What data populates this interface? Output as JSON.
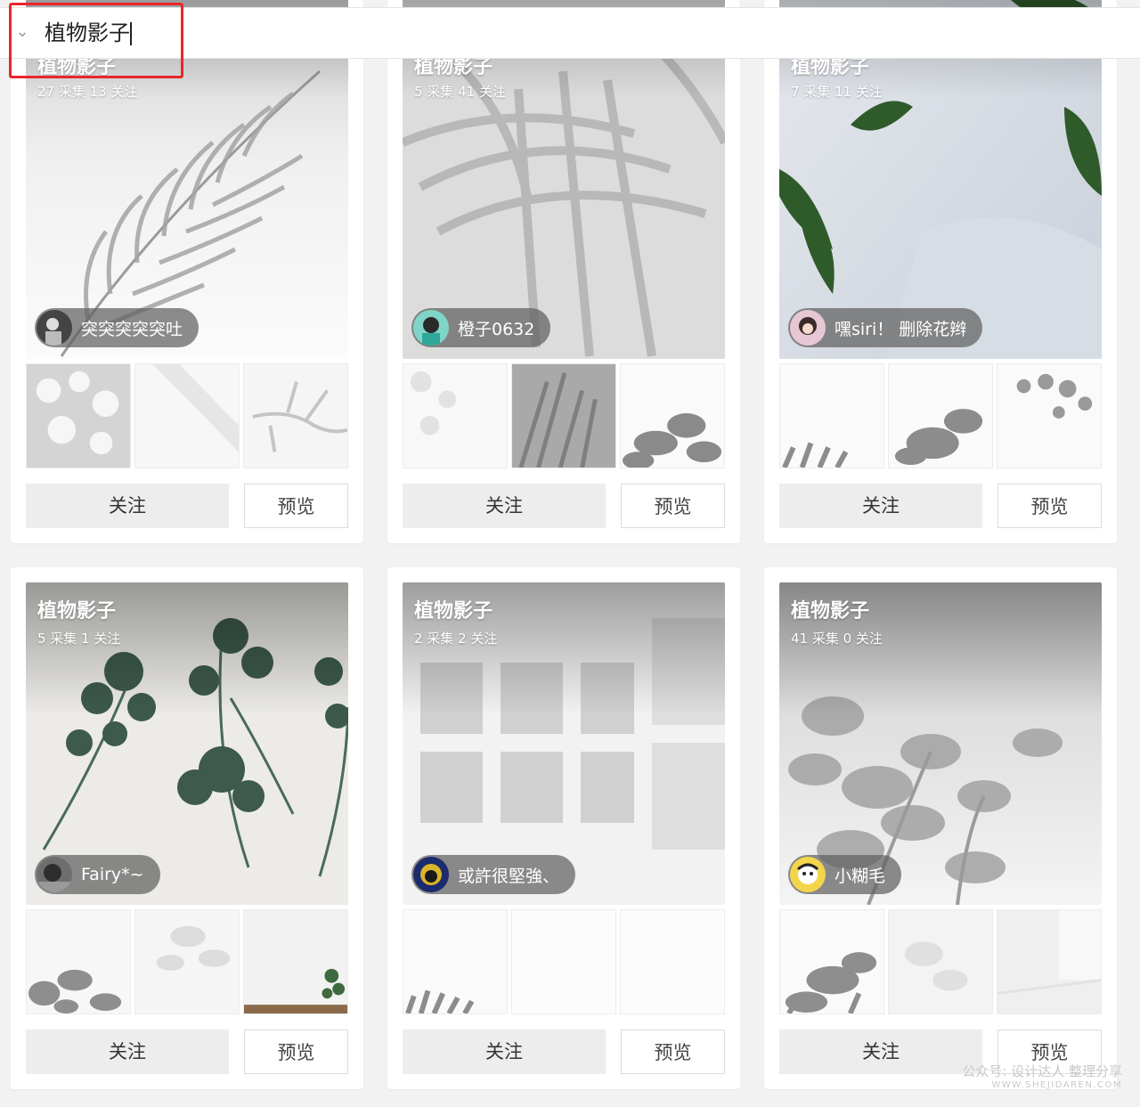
{
  "search": {
    "query": "植物影子"
  },
  "cards": [
    {
      "title": "植物影子",
      "stats": "27 采集  13 关注",
      "user": "突突突突突吐",
      "follow": "关注",
      "preview": "预览"
    },
    {
      "title": "植物影子",
      "stats": "5 采集  41 关注",
      "user": "橙子0632",
      "follow": "关注",
      "preview": "预览"
    },
    {
      "title": "植物影子",
      "stats": "7 采集  11 关注",
      "user": "嘿siri！ 删除花辫",
      "follow": "关注",
      "preview": "预览"
    },
    {
      "title": "植物影子",
      "stats": "5 采集  1 关注",
      "user": "Fairy*~",
      "follow": "关注",
      "preview": "预览"
    },
    {
      "title": "植物影子",
      "stats": "2 采集  2 关注",
      "user": "或許很堅強、",
      "follow": "关注",
      "preview": "预览"
    },
    {
      "title": "植物影子",
      "stats": "41 采集  0 关注",
      "user": "小糊毛",
      "follow": "关注",
      "preview": "预览"
    }
  ],
  "watermark": {
    "line1": "公众号: 设计达人 整理分享",
    "line2": "WWW.SHEJIDAREN.COM"
  },
  "colors": {
    "highlight_box": "#e8262b",
    "page_bg": "#f2f2f2",
    "follow_bg": "#ededed"
  }
}
